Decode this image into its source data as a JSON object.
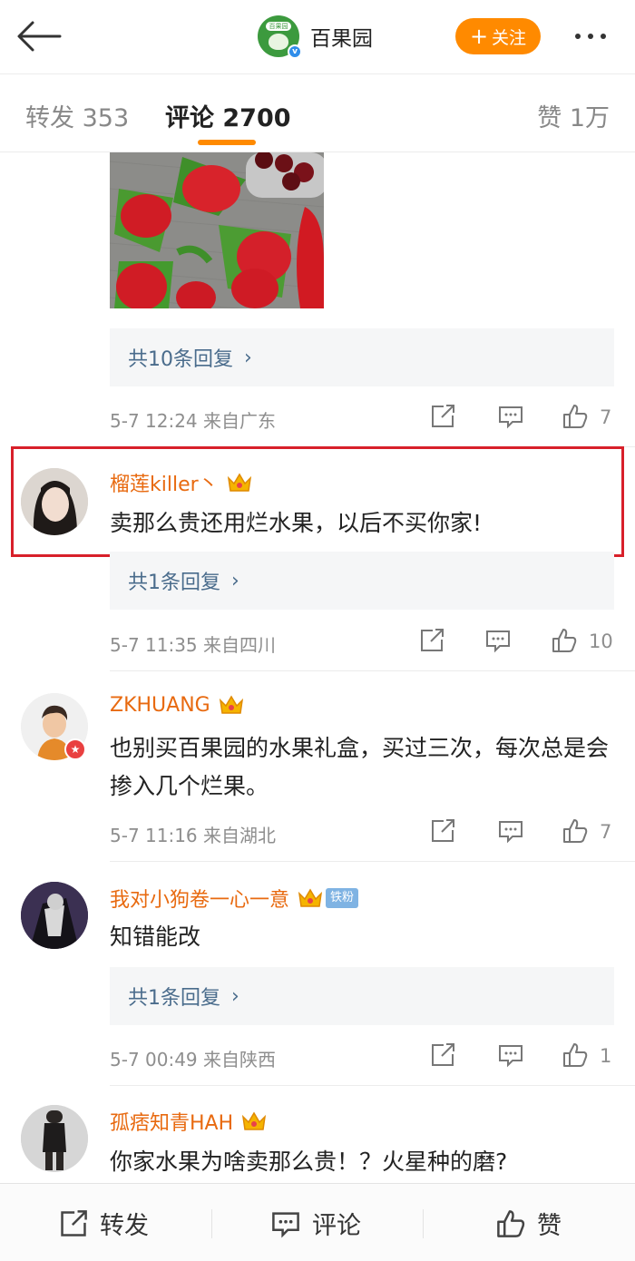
{
  "header": {
    "account_name": "百果园",
    "logo_text": "百果园",
    "follow_label": "关注"
  },
  "tabs": [
    {
      "label": "转发 353"
    },
    {
      "label": "评论 2700"
    },
    {
      "label": "赞 1万"
    }
  ],
  "first_comment_tail": {
    "reply_link": "共10条回复",
    "time": "5-7 12:24 来自广东",
    "likes": "7"
  },
  "comments": [
    {
      "name": "榴莲killer丶",
      "text": "卖那么贵还用烂水果，以后不买你家!",
      "reply_link": "共1条回复",
      "time": "5-7 11:35 来自四川",
      "likes": "10"
    },
    {
      "name": "ZKHUANG",
      "text": "也别买百果园的水果礼盒，买过三次，每次总是会掺入几个烂果。",
      "time": "5-7 11:16 来自湖北",
      "likes": "7"
    },
    {
      "name": "我对小狗卷一心一意",
      "badge": "铁粉",
      "text": "知错能改",
      "reply_link": "共1条回复",
      "time": "5-7 00:49 来自陕西",
      "likes": "1"
    },
    {
      "name": "孤痞知青HAH",
      "text": "你家水果为啥卖那么贵！？火星种的磨?"
    }
  ],
  "bottom_bar": {
    "repost": "转发",
    "comment": "评论",
    "like": "赞"
  },
  "colors": {
    "accent": "#ff8a00",
    "username": "#e86a10",
    "reply_link": "#4a6c8c",
    "highlight_border": "#d8202a"
  }
}
